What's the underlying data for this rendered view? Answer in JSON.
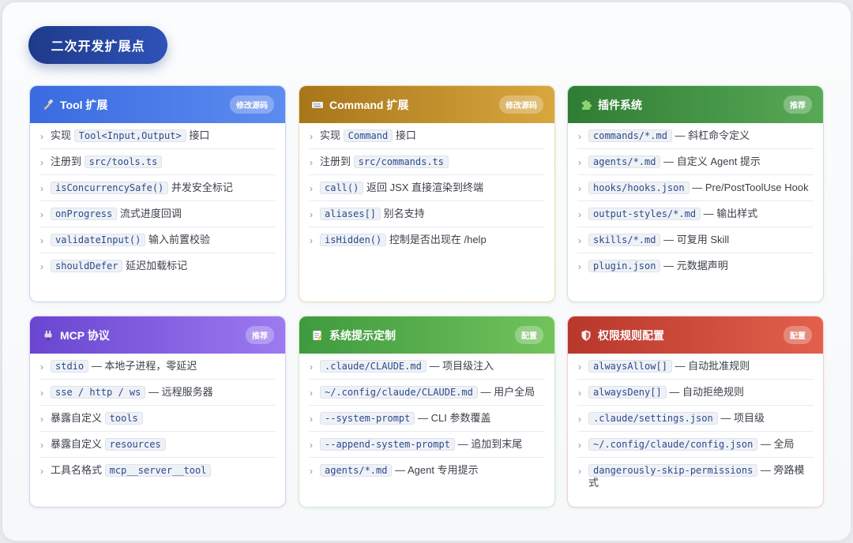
{
  "page_title": "二次开发扩展点",
  "cards": [
    {
      "title": "Tool 扩展",
      "icon": "hammer-icon",
      "badge": "修改源码",
      "gradient": [
        "#3a6be0",
        "#5d8cf0"
      ],
      "border": "#c7d6f3",
      "items": [
        {
          "pre": "实现",
          "code": "Tool<Input,Output>",
          "post": "接口"
        },
        {
          "pre": "注册到",
          "code": "src/tools.ts",
          "post": ""
        },
        {
          "pre": "",
          "code": "isConcurrencySafe()",
          "post": "并发安全标记"
        },
        {
          "pre": "",
          "code": "onProgress",
          "post": "流式进度回调"
        },
        {
          "pre": "",
          "code": "validateInput()",
          "post": "输入前置校验"
        },
        {
          "pre": "",
          "code": "shouldDefer",
          "post": "延迟加载标记"
        }
      ]
    },
    {
      "title": "Command 扩展",
      "icon": "keyboard-icon",
      "badge": "修改源码",
      "gradient": [
        "#a8761a",
        "#d8a73e"
      ],
      "border": "#f0dcae",
      "items": [
        {
          "pre": "实现",
          "code": "Command",
          "post": "接口"
        },
        {
          "pre": "注册到",
          "code": "src/commands.ts",
          "post": ""
        },
        {
          "pre": "",
          "code": "call()",
          "post": "返回 JSX 直接渲染到终端"
        },
        {
          "pre": "",
          "code": "aliases[]",
          "post": "别名支持"
        },
        {
          "pre": "",
          "code": "isHidden()",
          "post": "控制是否出现在 /help"
        }
      ]
    },
    {
      "title": "插件系统",
      "icon": "puzzle-icon",
      "badge": "推荐",
      "gradient": [
        "#2f7d35",
        "#58a956"
      ],
      "border": "#cfe6cd",
      "items": [
        {
          "pre": "",
          "code": "commands/*.md",
          "post": "— 斜杠命令定义"
        },
        {
          "pre": "",
          "code": "agents/*.md",
          "post": "— 自定义 Agent 提示"
        },
        {
          "pre": "",
          "code": "hooks/hooks.json",
          "post": "— Pre/PostToolUse Hook"
        },
        {
          "pre": "",
          "code": "output-styles/*.md",
          "post": "— 输出样式"
        },
        {
          "pre": "",
          "code": "skills/*.md",
          "post": "— 可复用 Skill"
        },
        {
          "pre": "",
          "code": "plugin.json",
          "post": "— 元数据声明"
        }
      ]
    },
    {
      "title": "MCP 协议",
      "icon": "plug-icon",
      "badge": "推荐",
      "gradient": [
        "#6a45d0",
        "#9c7af0"
      ],
      "border": "#d9cef5",
      "items": [
        {
          "pre": "",
          "code": "stdio",
          "post": "— 本地子进程，零延迟"
        },
        {
          "pre": "",
          "code": "sse / http / ws",
          "post": "— 远程服务器"
        },
        {
          "pre": "暴露自定义",
          "code": "tools",
          "post": ""
        },
        {
          "pre": "暴露自定义",
          "code": "resources",
          "post": ""
        },
        {
          "pre": "工具名格式",
          "code": "mcp__server__tool",
          "post": ""
        }
      ]
    },
    {
      "title": "系统提示定制",
      "icon": "memo-icon",
      "badge": "配置",
      "gradient": [
        "#3f9a3f",
        "#72c35c"
      ],
      "border": "#d3ebcc",
      "items": [
        {
          "pre": "",
          "code": ".claude/CLAUDE.md",
          "post": "— 项目级注入"
        },
        {
          "pre": "",
          "code": "~/.config/claude/CLAUDE.md",
          "post": "— 用户全局"
        },
        {
          "pre": "",
          "code": "--system-prompt",
          "post": "— CLI 参数覆盖"
        },
        {
          "pre": "",
          "code": "--append-system-prompt",
          "post": "— 追加到末尾"
        },
        {
          "pre": "",
          "code": "agents/*.md",
          "post": "— Agent 专用提示"
        }
      ]
    },
    {
      "title": "权限规则配置",
      "icon": "shield-icon",
      "badge": "配置",
      "gradient": [
        "#b8372b",
        "#e2604c"
      ],
      "border": "#f2cfc9",
      "items": [
        {
          "pre": "",
          "code": "alwaysAllow[]",
          "post": "— 自动批准规则"
        },
        {
          "pre": "",
          "code": "alwaysDeny[]",
          "post": "— 自动拒绝规则"
        },
        {
          "pre": "",
          "code": ".claude/settings.json",
          "post": "— 项目级"
        },
        {
          "pre": "",
          "code": "~/.config/claude/config.json",
          "post": "— 全局"
        },
        {
          "pre": "",
          "code": "dangerously-skip-permissions",
          "post": "— 旁路模式"
        }
      ]
    }
  ]
}
